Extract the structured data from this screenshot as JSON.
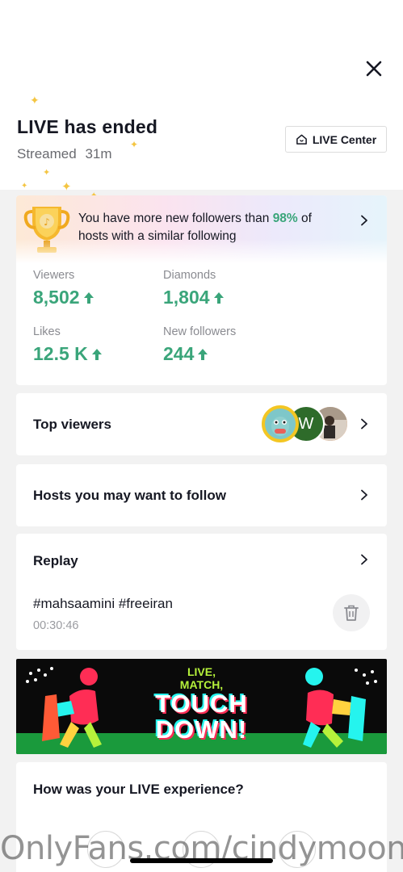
{
  "header": {
    "title": "LIVE has ended",
    "streamed_label": "Streamed",
    "streamed_duration": "31m",
    "live_center_label": "LIVE Center"
  },
  "summary": {
    "banner_text_before": "You have more new followers than ",
    "banner_percent": "98%",
    "banner_text_after": " of hosts with a similar following",
    "stats": [
      {
        "label": "Viewers",
        "value": "8,502"
      },
      {
        "label": "Diamonds",
        "value": "1,804"
      },
      {
        "label": "Likes",
        "value": "12.5 K"
      },
      {
        "label": "New followers",
        "value": "244"
      }
    ]
  },
  "top_viewers": {
    "label": "Top viewers",
    "avatar_letter": "W"
  },
  "hosts": {
    "label": "Hosts you may want to follow"
  },
  "replay": {
    "label": "Replay",
    "tags": "#mahsaamini #freeiran",
    "duration": "00:30:46"
  },
  "promo": {
    "line1": "LIVE,",
    "line2": "MATCH,",
    "line3": "TOUCH",
    "line4": "DOWN!"
  },
  "feedback": {
    "question": "How was your LIVE experience?"
  },
  "watermark": "OnlyFans.com/cindymoon",
  "colors": {
    "accent_green": "#3aa57a",
    "ad_green": "#1a9a3c",
    "ad_lime": "#b6f23b",
    "sparkle": "#f4c542"
  }
}
